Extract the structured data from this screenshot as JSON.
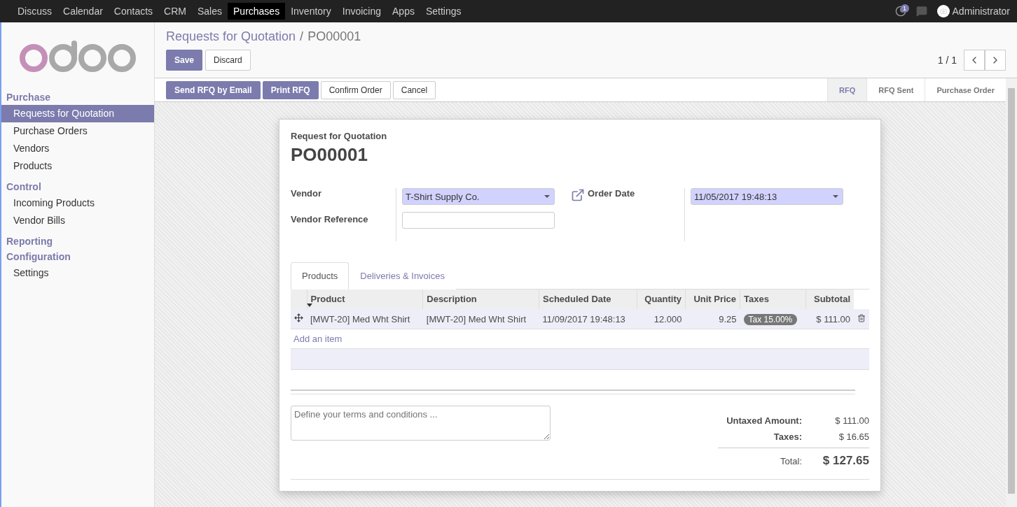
{
  "top_menu": [
    {
      "label": "Discuss",
      "selected": false
    },
    {
      "label": "Calendar",
      "selected": false
    },
    {
      "label": "Contacts",
      "selected": false
    },
    {
      "label": "CRM",
      "selected": false
    },
    {
      "label": "Sales",
      "selected": false
    },
    {
      "label": "Purchases",
      "selected": true
    },
    {
      "label": "Inventory",
      "selected": false
    },
    {
      "label": "Invoicing",
      "selected": false
    },
    {
      "label": "Apps",
      "selected": false
    },
    {
      "label": "Settings",
      "selected": false
    }
  ],
  "systray": {
    "activity_count": "1",
    "user": "Administrator"
  },
  "sidebar": {
    "sections": [
      {
        "title": "Purchase",
        "items": [
          {
            "label": "Requests for Quotation",
            "selected": true
          },
          {
            "label": "Purchase Orders",
            "selected": false
          },
          {
            "label": "Vendors",
            "selected": false
          },
          {
            "label": "Products",
            "selected": false
          }
        ]
      },
      {
        "title": "Control",
        "items": [
          {
            "label": "Incoming Products",
            "selected": false
          },
          {
            "label": "Vendor Bills",
            "selected": false
          }
        ]
      },
      {
        "title": "Reporting"
      },
      {
        "title": "Configuration",
        "items": [
          {
            "label": "Settings",
            "selected": false
          }
        ]
      }
    ]
  },
  "breadcrumb": {
    "parent": "Requests for Quotation",
    "separator": "/",
    "current": "PO00001"
  },
  "actions": [
    {
      "label": "Save",
      "kind": "primary"
    },
    {
      "label": "Discard",
      "kind": "default"
    }
  ],
  "pager": "1 / 1",
  "header_buttons": [
    {
      "label": "Send RFQ by Email",
      "kind": "primary"
    },
    {
      "label": "Print RFQ",
      "kind": "primary"
    },
    {
      "label": "Confirm Order",
      "kind": "default"
    },
    {
      "label": "Cancel",
      "kind": "default"
    }
  ],
  "statusbar": [
    {
      "label": "RFQ",
      "selected": true
    },
    {
      "label": "RFQ Sent",
      "selected": false
    },
    {
      "label": "Purchase Order",
      "selected": false
    }
  ],
  "sheet": {
    "subtitle": "Request for Quotation",
    "name": "PO00001",
    "vendor_label": "Vendor",
    "vendor": "T-Shirt Supply Co.",
    "vendor_ref_label": "Vendor Reference",
    "order_date_label": "Order Date",
    "order_date": "11/05/2017 19:48:13",
    "tabs": [
      {
        "label": "Products",
        "selected": true
      },
      {
        "label": "Deliveries & Invoices",
        "selected": false
      }
    ],
    "table": {
      "columns": [
        "Product",
        "Description",
        "Scheduled Date",
        "Quantity",
        "Unit Price",
        "Taxes",
        "Subtotal"
      ],
      "rows": [
        {
          "product": "[MWT-20] Med Wht Shirt",
          "description": "[MWT-20] Med Wht Shirt",
          "scheduled_date": "11/09/2017 19:48:13",
          "quantity": "12.000",
          "unit_price": "9.25",
          "taxes": "Tax 15.00%",
          "subtotal": "$ 111.00"
        }
      ],
      "add_item": "Add an item"
    },
    "notes_placeholder": "Define your terms and conditions ...",
    "totals": {
      "untaxed_label": "Untaxed Amount:",
      "untaxed": "$ 111.00",
      "taxes_label": "Taxes:",
      "taxes": "$ 16.65",
      "total_label": "Total:",
      "total": "$ 127.65"
    }
  }
}
